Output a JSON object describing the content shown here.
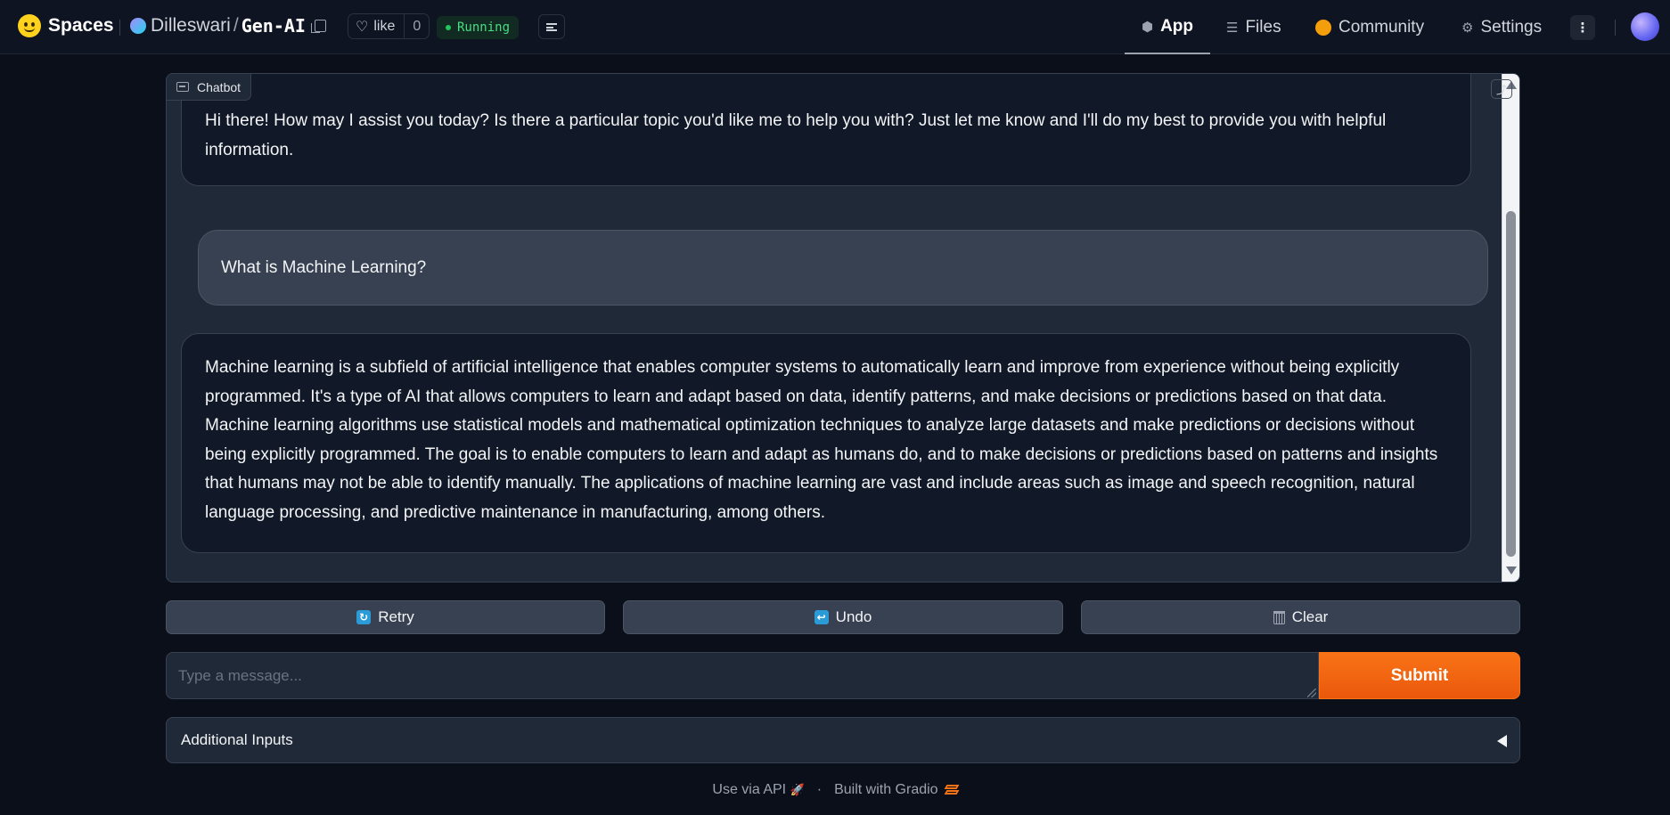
{
  "header": {
    "brand": "Spaces",
    "owner": "Dilleswari",
    "separator": "/",
    "repo_name": "Gen-AI",
    "like_label": "like",
    "like_count": "0",
    "status": "Running",
    "nav": {
      "app": "App",
      "files": "Files",
      "community": "Community",
      "settings": "Settings"
    }
  },
  "chatbot": {
    "label": "Chatbot",
    "messages": [
      {
        "role": "bot",
        "text": "Hi there! How may I assist you today? Is there a particular topic you'd like me to help you with? Just let me know and I'll do my best to provide you with helpful information."
      },
      {
        "role": "user",
        "text": "What is Machine Learning?"
      },
      {
        "role": "bot",
        "text": "Machine learning is a subfield of artificial intelligence that enables computer systems to automatically learn and improve from experience without being explicitly programmed. It's a type of AI that allows computers to learn and adapt based on data, identify patterns, and make decisions or predictions based on that data. Machine learning algorithms use statistical models and mathematical optimization techniques to analyze large datasets and make predictions or decisions without being explicitly programmed. The goal is to enable computers to learn and adapt as humans do, and to make decisions or predictions based on patterns and insights that humans may not be able to identify manually. The applications of machine learning are vast and include areas such as image and speech recognition, natural language processing, and predictive maintenance in manufacturing, among others."
      }
    ]
  },
  "buttons": {
    "retry": "Retry",
    "undo": "Undo",
    "clear": "Clear",
    "submit": "Submit"
  },
  "input": {
    "placeholder": "Type a message...",
    "value": ""
  },
  "accordion": {
    "label": "Additional Inputs"
  },
  "footer": {
    "api": "Use via API",
    "separator": "·",
    "built": "Built with Gradio"
  },
  "colors": {
    "accent": "#f97316",
    "status": "#22c55e",
    "background": "#0b0f19"
  }
}
